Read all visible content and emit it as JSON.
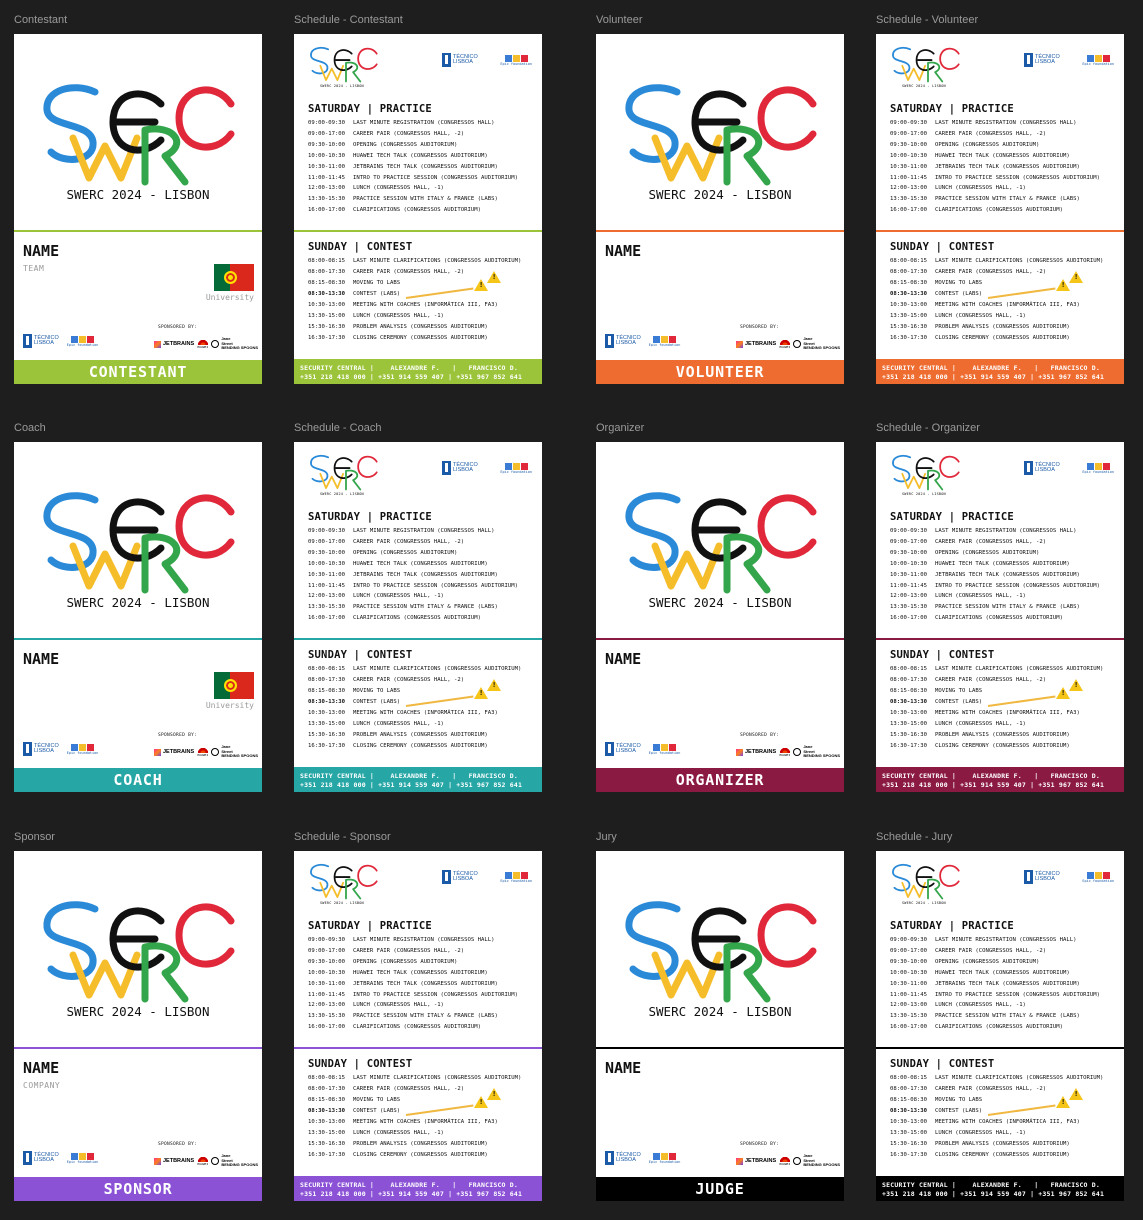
{
  "badge_title": "SWERC 2024 - LISBON",
  "name_label": "NAME",
  "university_label": "University",
  "sponsored_by": "SPONSORED BY:",
  "tecnico": {
    "line1": "TÉCNICO",
    "line2": "LISBOA"
  },
  "epic_label": "Epic foundation",
  "sponsors": {
    "jetbrains": "JETBRAINS",
    "huawei": "HUAWEI",
    "janestreet1": "Jane",
    "janestreet2": "Street",
    "bending": "BENDING SPOONS"
  },
  "colors": {
    "contestant": "#9cc43a",
    "volunteer": "#ee6c30",
    "coach": "#27a6a6",
    "organizer": "#8b1a43",
    "sponsor": "#8b52d6",
    "jury": "#000000",
    "logo_blue": "#2a8ad8",
    "logo_yellow": "#f5bd2a",
    "logo_black": "#111111",
    "logo_green": "#33a54a",
    "logo_red": "#e0283a"
  },
  "frames": [
    {
      "label": "Contestant",
      "role": "CONTESTANT",
      "sub": "TEAM",
      "flag": true
    },
    {
      "label": "Schedule - Contestant"
    },
    {
      "label": "Volunteer",
      "role": "VOLUNTEER"
    },
    {
      "label": "Schedule - Volunteer"
    },
    {
      "label": "Coach",
      "role": "COACH",
      "flag": true
    },
    {
      "label": "Schedule - Coach"
    },
    {
      "label": "Organizer",
      "role": "ORGANIZER"
    },
    {
      "label": "Schedule - Organizer"
    },
    {
      "label": "Sponsor",
      "role": "SPONSOR",
      "sub": "COMPANY"
    },
    {
      "label": "Schedule - Sponsor"
    },
    {
      "label": "Jury",
      "role": "JUDGE"
    },
    {
      "label": "Schedule - Jury"
    }
  ],
  "schedule": {
    "logo_caption": "SWERC 2024 - LISBON",
    "saturday": {
      "title": "SATURDAY | PRACTICE",
      "events": [
        {
          "time": "09:00-09:30",
          "text": "LAST MINUTE REGISTRATION (CONGRESSOS HALL)"
        },
        {
          "time": "09:00-17:00",
          "text": "CAREER FAIR (CONGRESSOS HALL, -2)"
        },
        {
          "time": "09:30-10:00",
          "text": "OPENING (CONGRESSOS AUDITORIUM)"
        },
        {
          "time": "10:00-10:30",
          "text": "HUAWEI TECH TALK (CONGRESSOS AUDITORIUM)"
        },
        {
          "time": "10:30-11:00",
          "text": "JETBRAINS TECH TALK (CONGRESSOS AUDITORIUM)"
        },
        {
          "time": "11:00-11:45",
          "text": "INTRO TO PRACTICE SESSION (CONGRESSOS AUDITORIUM)"
        },
        {
          "time": "12:00-13:00",
          "text": "LUNCH (CONGRESSOS HALL, -1)"
        },
        {
          "time": "13:30-15:30",
          "text": "PRACTICE SESSION WITH ITALY & FRANCE (LABS)"
        },
        {
          "time": "16:00-17:00",
          "text": "CLARIFICATIONS (CONGRESSOS AUDITORIUM)"
        }
      ]
    },
    "sunday": {
      "title": "SUNDAY | CONTEST",
      "events": [
        {
          "time": "08:00-08:15",
          "text": "LAST MINUTE CLARIFICATIONS (CONGRESSOS AUDITORIUM)"
        },
        {
          "time": "08:00-17:30",
          "text": "CAREER FAIR (CONGRESSOS HALL, -2)"
        },
        {
          "time": "08:15-08:30",
          "text": "MOVING TO LABS"
        },
        {
          "time": "08:30-13:30",
          "text": "CONTEST (LABS)",
          "bold": true
        },
        {
          "time": "10:30-13:00",
          "text": "MEETING WITH COACHES (INFORMÁTICA III, FA3)"
        },
        {
          "time": "13:30-15:00",
          "text": "LUNCH (CONGRESSOS HALL, -1)"
        },
        {
          "time": "15:30-16:30",
          "text": "PROBLEM ANALYSIS (CONGRESSOS AUDITORIUM)"
        },
        {
          "time": "16:30-17:30",
          "text": "CLOSING CEREMONY (CONGRESSOS AUDITORIUM)"
        }
      ]
    },
    "footer": "SECURITY CENTRAL |    ALEXANDRE F.   |   FRANCISCO D.\n+351 218 418 000 | +351 914 559 407 | +351 967 852 641"
  }
}
